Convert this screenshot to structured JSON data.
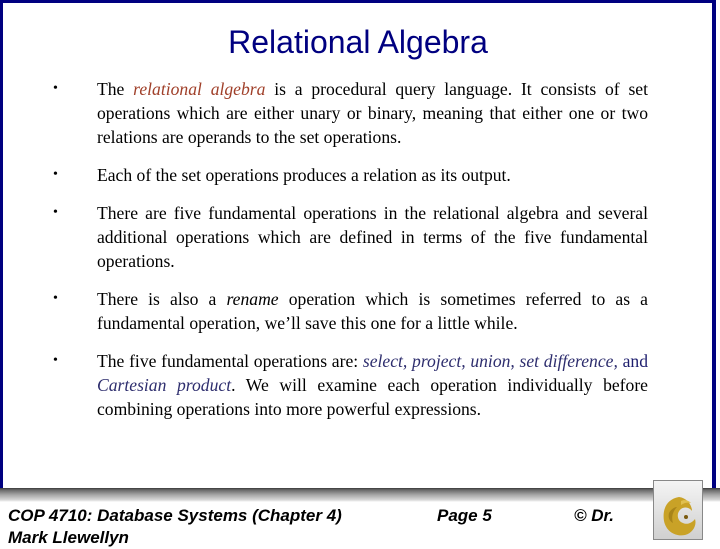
{
  "slide": {
    "title": "Relational Algebra",
    "bullets": [
      {
        "parts": [
          {
            "text": "The ",
            "style": "plain"
          },
          {
            "text": "relational algebra",
            "style": "red-italic"
          },
          {
            "text": " is a procedural query language.  It consists of set operations which are either unary or binary, meaning that either one or two relations are operands to the set operations.",
            "style": "plain"
          }
        ]
      },
      {
        "parts": [
          {
            "text": "Each of the set operations produces a relation as its output.",
            "style": "plain"
          }
        ]
      },
      {
        "parts": [
          {
            "text": "There are five fundamental operations in the relational algebra and several additional operations which are defined in terms of the five fundamental operations.",
            "style": "plain"
          }
        ]
      },
      {
        "parts": [
          {
            "text": "There is also a ",
            "style": "plain"
          },
          {
            "text": "rename",
            "style": "italic"
          },
          {
            "text": " operation which is sometimes referred to as a fundamental operation, we’ll save this one for a little while.",
            "style": "plain"
          }
        ]
      },
      {
        "parts": [
          {
            "text": "The five fundamental operations are: ",
            "style": "plain"
          },
          {
            "text": "select, project, union, set difference,",
            "style": "blue-italic"
          },
          {
            "text": " and ",
            "style": "blue"
          },
          {
            "text": "Cartesian product",
            "style": "blue-italic"
          },
          {
            "text": ".  We will examine each operation individually before combining operations into more powerful expressions.",
            "style": "plain"
          }
        ]
      }
    ],
    "bullet_glyph": "•"
  },
  "footer": {
    "course": "COP 4710: Database Systems  (Chapter 4)",
    "course_line2": "Mark Llewellyn",
    "page": "Page 5",
    "copyright": "© Dr.",
    "logo_icon": "pegasus-logo-icon"
  },
  "colors": {
    "title": "#000080",
    "frame": "#000080",
    "highlight_red": "#a0402a",
    "highlight_blue": "#2e2e6e",
    "logo_gold": "#c9a227"
  }
}
